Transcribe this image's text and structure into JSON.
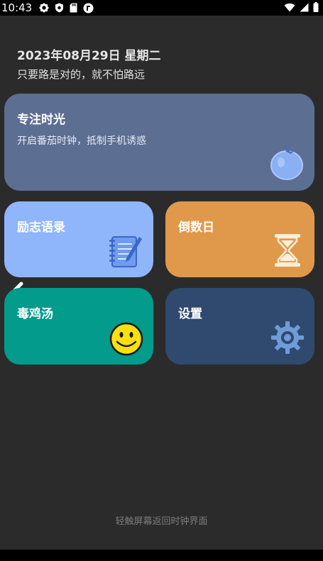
{
  "status": {
    "time": "10:43",
    "icons": [
      "gear-icon",
      "shield-icon",
      "sd-card-icon",
      "app-notification-icon"
    ],
    "right_icons": [
      "wifi-icon",
      "signal-icon",
      "battery-icon"
    ]
  },
  "header": {
    "date": "2023年08月29日 星期二",
    "motto": "只要路是对的，就不怕路远"
  },
  "cards": {
    "focus": {
      "title": "专注时光",
      "subtitle": "开启番茄时钟，抵制手机诱惑",
      "icon": "tomato-icon",
      "color": "#5d6e93"
    },
    "quotes": {
      "title": "励志语录",
      "icon": "notepad-icon",
      "color": "#8fb5fb"
    },
    "countdown": {
      "title": "倒数日",
      "icon": "hourglass-icon",
      "color": "#e0994b"
    },
    "soup": {
      "title": "毒鸡汤",
      "icon": "smiley-icon",
      "color": "#029b8c"
    },
    "settings": {
      "title": "设置",
      "icon": "gear-icon",
      "color": "#2f4a6e"
    }
  },
  "hint": "轻触屏幕返回时钟界面"
}
